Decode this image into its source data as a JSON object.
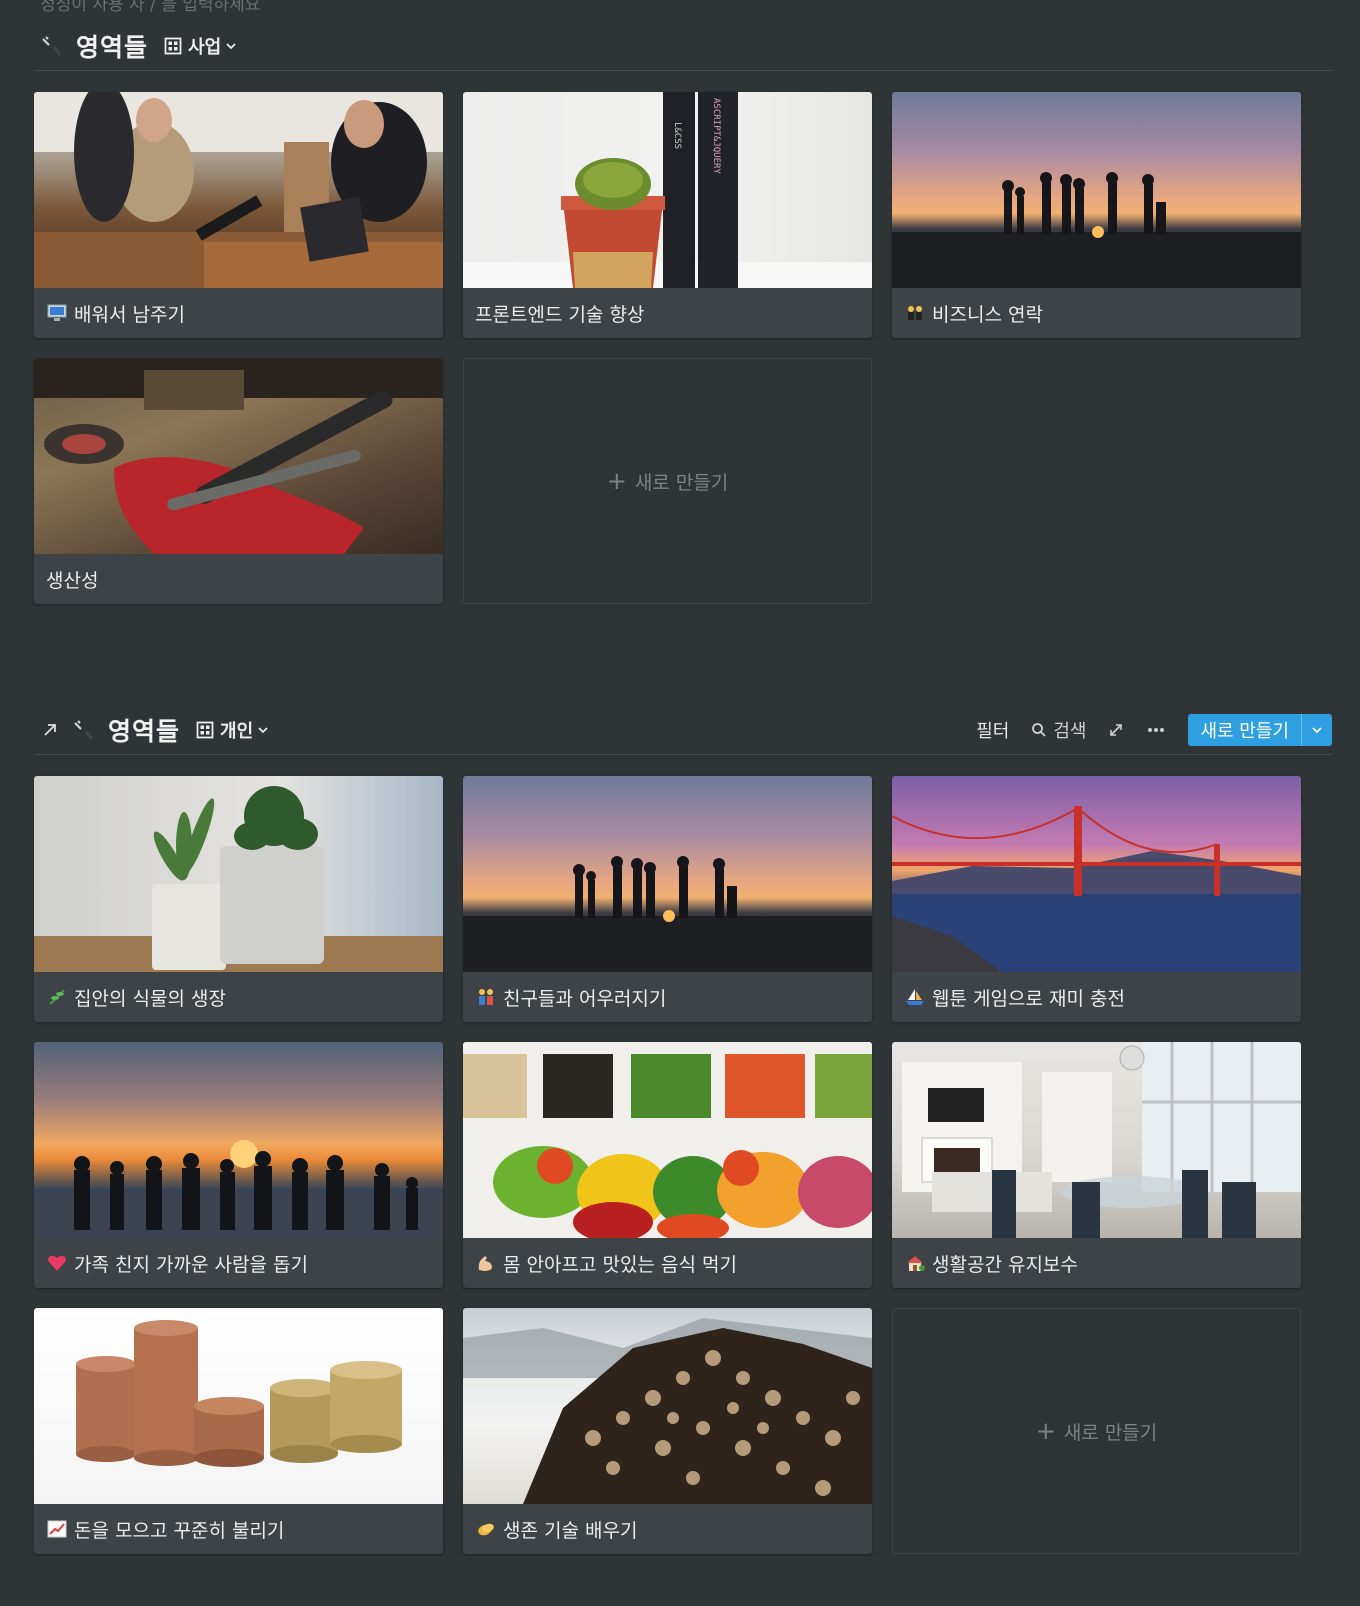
{
  "top_cut_text": "정성이 사용 자 / 을 입력하세요",
  "section_business": {
    "title": "영역들",
    "view_label": "사업",
    "cards": [
      {
        "title": "배워서 남주기",
        "emoji": "💻",
        "cover": "wine-shop"
      },
      {
        "title": "프론트엔드 기술 향상",
        "emoji": "",
        "cover": "cactus-books"
      },
      {
        "title": "비즈니스 연락",
        "emoji": "👯",
        "cover": "beach-sunset"
      },
      {
        "title": "생산성",
        "emoji": "",
        "cover": "workbench-tools"
      }
    ],
    "new_label": "새로 만들기"
  },
  "section_personal": {
    "title": "영역들",
    "view_label": "개인",
    "toolbar": {
      "filter": "필터",
      "search": "검색",
      "new_button": "새로 만들기"
    },
    "cards": [
      {
        "title": "집안의 식물의 생장",
        "emoji": "🌿",
        "cover": "potted-plants"
      },
      {
        "title": "친구들과 어우러지기",
        "emoji": "👫",
        "cover": "beach-sunset"
      },
      {
        "title": "웹툰 게임으로 재미 충전",
        "emoji": "⛵",
        "cover": "golden-gate-bridge"
      },
      {
        "title": "가족 친지 가까운 사람을 돕기",
        "emoji": "💖",
        "cover": "family-sunset"
      },
      {
        "title": "몸 안아프고 맛있는 음식 먹기",
        "emoji": "💪",
        "cover": "salad-bar"
      },
      {
        "title": "생활공간 유지보수",
        "emoji": "🏡",
        "cover": "living-room"
      },
      {
        "title": "돈을 모으고 꾸준히 불리기",
        "emoji": "📈",
        "cover": "coin-stacks"
      },
      {
        "title": "생존 기술 배우기",
        "emoji": "👏",
        "cover": "firewood-snow"
      }
    ],
    "new_label": "새로 만들기"
  },
  "icons": {
    "arrow": "arrow-up-right-icon",
    "database": "database-icon",
    "gallery": "gallery-view-icon",
    "chevron": "chevron-down-icon",
    "search": "search-icon",
    "expand": "expand-icon",
    "more": "more-icon"
  },
  "colors": {
    "background": "#2f3437",
    "card": "#3d4346",
    "accent": "#2e9fe0"
  }
}
